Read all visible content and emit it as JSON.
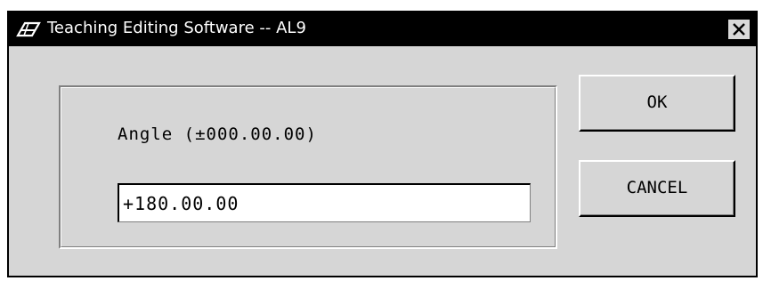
{
  "window": {
    "title": "Teaching Editing Software -- AL9",
    "icon": "app-editor-icon",
    "close_icon": "close-icon"
  },
  "form": {
    "label": "Angle (±000.00.00)",
    "value": "+180.00.00"
  },
  "buttons": {
    "ok_label": "OK",
    "cancel_label": "CANCEL"
  }
}
